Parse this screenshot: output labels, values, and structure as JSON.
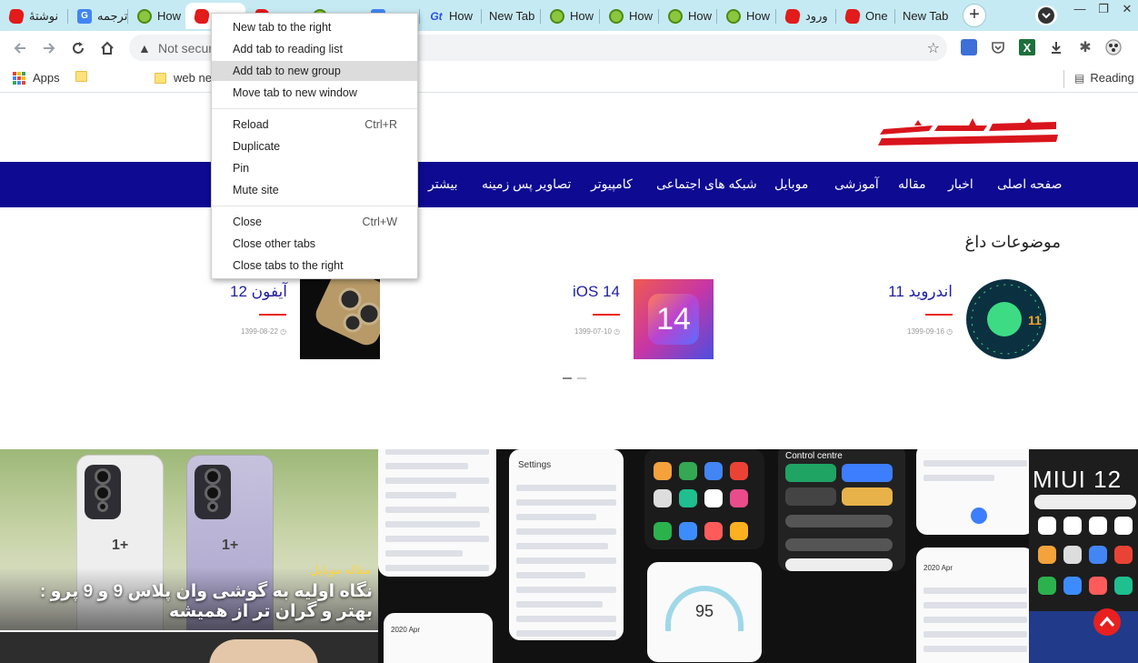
{
  "tabs": [
    {
      "label": "نوشتهٔ",
      "icon": "red-logo-icon"
    },
    {
      "label": "ترجمه",
      "icon": "google-translate-icon"
    },
    {
      "label": "How",
      "icon": "frog-icon"
    },
    {
      "label": "",
      "icon": "red-logo-icon"
    },
    {
      "label": "",
      "icon": "red-logo-icon"
    },
    {
      "label": "",
      "icon": "frog-icon"
    },
    {
      "label": "",
      "icon": "blue-site-icon"
    },
    {
      "label": "How",
      "icon": "gt-icon"
    },
    {
      "label": "New Tab",
      "icon": ""
    },
    {
      "label": "How",
      "icon": "frog-icon"
    },
    {
      "label": "How",
      "icon": "frog-icon"
    },
    {
      "label": "How",
      "icon": "frog-icon"
    },
    {
      "label": "How",
      "icon": "frog-icon"
    },
    {
      "label": "ورود",
      "icon": "red-logo-icon"
    },
    {
      "label": "One",
      "icon": "red-logo-icon"
    },
    {
      "label": "New Tab",
      "icon": ""
    }
  ],
  "toolbar": {
    "omnibox_text": "Not secur"
  },
  "bookmarks": {
    "apps_label": "Apps",
    "folder2_label": "web ne",
    "reading_label": "Reading"
  },
  "site": {
    "nav": [
      "صفحه اصلی",
      "اخبار",
      "مقاله",
      "آموزشی",
      "موبایل",
      "شبکه های اجتماعی",
      "کامپیوتر",
      "تصاویر پس زمینه",
      "بیشتر"
    ],
    "section_title": "موضوعات داغ",
    "cards": [
      {
        "title": "اندروید 11",
        "date": "1399-09-16",
        "image": "android-11-logo"
      },
      {
        "title": "iOS 14",
        "date": "1399-07-10",
        "image": "ios-14-logo",
        "image_text": "14"
      },
      {
        "title": "آیفون 12",
        "date": "1399-08-22",
        "image": "iphone-12-photo"
      }
    ],
    "banner": {
      "category": "مقاله موبایل",
      "title": "نگاه اولیه به گوشی وان پلاس 9 و 9 پرو : بهتر و گران تر از همیشه"
    },
    "miui_label": "MIUI 12",
    "settings_title": "Settings",
    "control_centre": "Control centre",
    "calendar_month": "2020 Apr",
    "gauge_value": "95"
  },
  "context_menu": {
    "items": [
      {
        "label": "New tab to the right",
        "shortcut": ""
      },
      {
        "label": "Add tab to reading list",
        "shortcut": ""
      },
      {
        "label": "Add tab to new group",
        "shortcut": "",
        "highlighted": true
      },
      {
        "label": "Move tab to new window",
        "shortcut": ""
      },
      {
        "label": "Reload",
        "shortcut": "Ctrl+R"
      },
      {
        "label": "Duplicate",
        "shortcut": ""
      },
      {
        "label": "Pin",
        "shortcut": ""
      },
      {
        "label": "Mute site",
        "shortcut": ""
      },
      {
        "label": "Close",
        "shortcut": "Ctrl+W"
      },
      {
        "label": "Close other tabs",
        "shortcut": ""
      },
      {
        "label": "Close tabs to the right",
        "shortcut": ""
      }
    ]
  },
  "colors": {
    "tabstrip": "#c6eaf3",
    "navbar": "#0e0a92",
    "accent_red": "#e22222",
    "link_blue": "#1f1fa2"
  }
}
